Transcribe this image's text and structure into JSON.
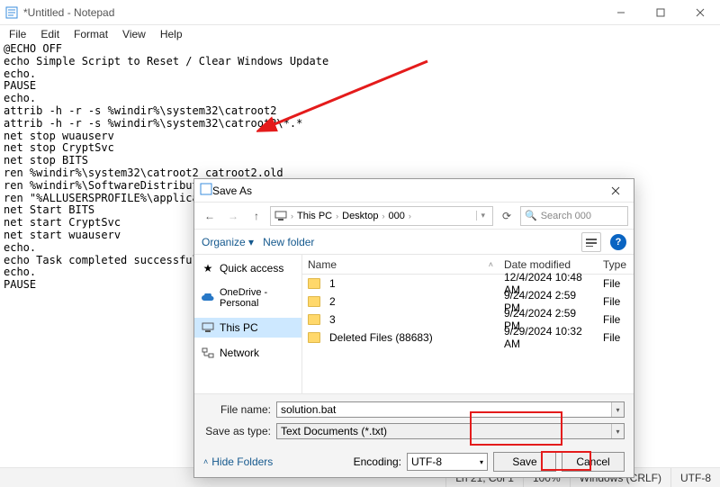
{
  "notepad": {
    "title": "*Untitled - Notepad",
    "menu": {
      "file": "File",
      "edit": "Edit",
      "format": "Format",
      "view": "View",
      "help": "Help"
    },
    "text": "@ECHO OFF\necho Simple Script to Reset / Clear Windows Update\necho.\nPAUSE\necho.\nattrib -h -r -s %windir%\\system32\\catroot2\nattrib -h -r -s %windir%\\system32\\catroot2\\*.*\nnet stop wuauserv\nnet stop CryptSvc\nnet stop BITS\nren %windir%\\system32\\catroot2 catroot2.old\nren %windir%\\SoftwareDistribution sold.old\nren \"%ALLUSERSPROFILE%\\application data\\Microsoft\\Network\\downloader\" downloader.old\nnet Start BITS\nnet start CryptSvc\nnet start wuauserv\necho.\necho Task completed successfully...\necho.\nPAUSE",
    "status": {
      "lncol": "Ln 21, Col 1",
      "zoom": "100%",
      "eol": "Windows (CRLF)",
      "enc": "UTF-8"
    }
  },
  "saveas": {
    "title": "Save As",
    "breadcrumb": {
      "a": "This PC",
      "b": "Desktop",
      "c": "000"
    },
    "search_placeholder": "Search 000",
    "toolbar": {
      "organize": "Organize ▾",
      "newfolder": "New folder"
    },
    "side": {
      "qa": "Quick access",
      "od": "OneDrive - Personal",
      "pc": "This PC",
      "net": "Network"
    },
    "cols": {
      "name": "Name",
      "date": "Date modified",
      "type": "Type"
    },
    "items": [
      {
        "name": "1",
        "date": "12/4/2024 10:48 AM",
        "type": "File"
      },
      {
        "name": "2",
        "date": "9/24/2024 2:59 PM",
        "type": "File"
      },
      {
        "name": "3",
        "date": "9/24/2024 2:59 PM",
        "type": "File"
      },
      {
        "name": "Deleted Files (88683)",
        "date": "9/29/2024 10:32 AM",
        "type": "File"
      }
    ],
    "filename_label": "File name:",
    "filename_value": "solution.bat",
    "saveastype_label": "Save as type:",
    "saveastype_value": "Text Documents (*.txt)",
    "hidefolders": "Hide Folders",
    "encoding_label": "Encoding:",
    "encoding_value": "UTF-8",
    "save": "Save",
    "cancel": "Cancel"
  }
}
